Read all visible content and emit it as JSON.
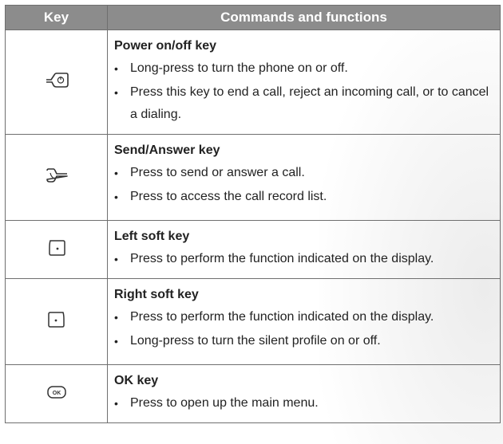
{
  "header": {
    "key": "Key",
    "commands": "Commands and functions"
  },
  "rows": [
    {
      "icon": "power-end-key-icon",
      "title": "Power on/off key",
      "bullets": [
        "Long-press to turn the phone on or off.",
        "Press this key to end a call, reject an incoming call, or to cancel a dialing."
      ]
    },
    {
      "icon": "send-answer-key-icon",
      "title": "Send/Answer key",
      "bullets": [
        "Press to send or answer a call.",
        "Press to access the call record list."
      ]
    },
    {
      "icon": "left-soft-key-icon",
      "title": "Left soft key",
      "bullets": [
        "Press to perform the function indicated on the display."
      ]
    },
    {
      "icon": "right-soft-key-icon",
      "title": "Right soft key",
      "bullets": [
        "Press to perform the function indicated on the display.",
        "Long-press to turn the silent profile on or off."
      ]
    },
    {
      "icon": "ok-key-icon",
      "title": "OK key",
      "bullets": [
        "Press to open up the main menu."
      ],
      "icon_label": "OK"
    }
  ]
}
